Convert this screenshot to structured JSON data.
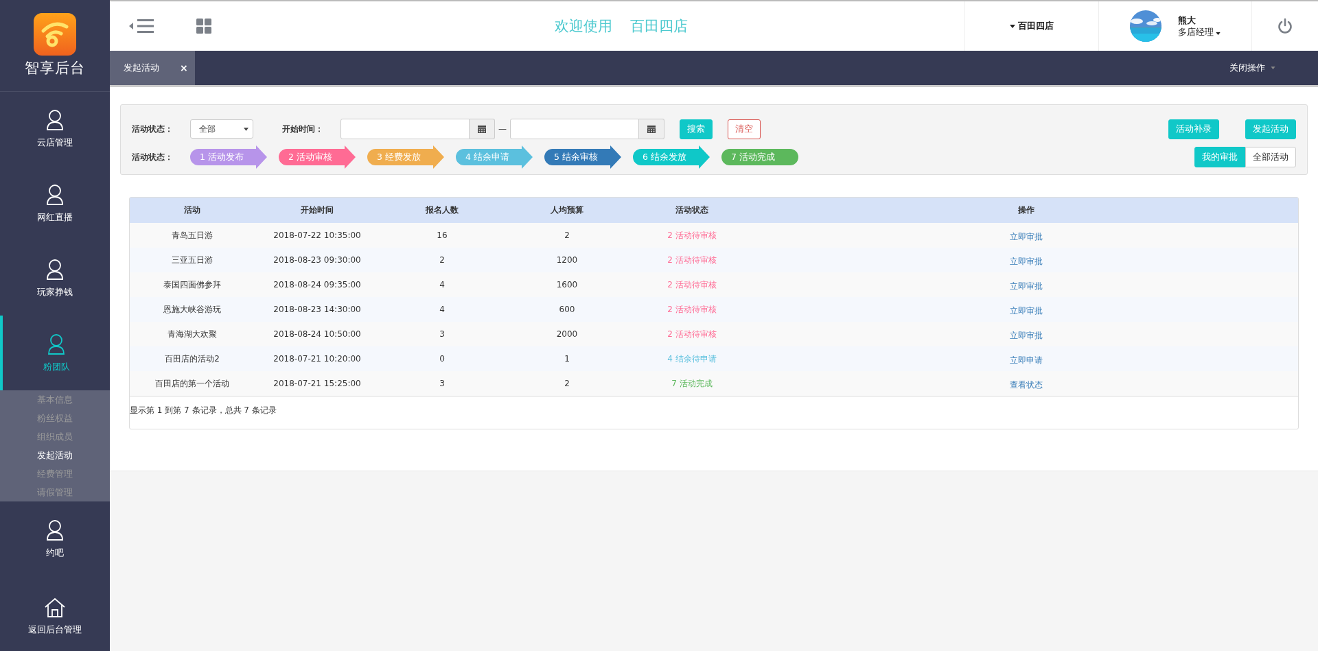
{
  "sidebar": {
    "logo_text": "智享后台",
    "items": [
      {
        "label": "云店管理",
        "kind": "user",
        "selected": false
      },
      {
        "label": "网红直播",
        "kind": "user",
        "selected": false
      },
      {
        "label": "玩家挣钱",
        "kind": "user",
        "selected": false
      },
      {
        "label": "粉团队",
        "kind": "user",
        "selected": true,
        "children": [
          {
            "label": "基本信息",
            "selected": false
          },
          {
            "label": "粉丝权益",
            "selected": false
          },
          {
            "label": "组织成员",
            "selected": false
          },
          {
            "label": "发起活动",
            "selected": true
          },
          {
            "label": "经费管理",
            "selected": false
          },
          {
            "label": "请假管理",
            "selected": false
          }
        ]
      },
      {
        "label": "约吧",
        "kind": "user",
        "selected": false
      },
      {
        "label": "返回后台管理",
        "kind": "home",
        "selected": false
      }
    ]
  },
  "header": {
    "welcome": "欢迎使用",
    "store_title": "百田四店",
    "store_menu": "百田四店",
    "user_name": "熊大",
    "user_role": "多店经理"
  },
  "tabs": [
    {
      "label": "发起活动",
      "selected": true,
      "close": "×"
    }
  ],
  "close_actions": "关闭操作",
  "filters": {
    "status_label": "活动状态：",
    "status_value": "全部",
    "time_label": "开始时间：",
    "separator": "—",
    "search": "搜索",
    "clear": "清空",
    "supplement": "活动补录",
    "launch": "发起活动",
    "steps_label": "活动状态：",
    "steps": [
      {
        "label": "1 活动发布",
        "color": "#b794ea"
      },
      {
        "label": "2 活动审核",
        "color": "#ff6b94"
      },
      {
        "label": "3 经费发放",
        "color": "#f0ad4e"
      },
      {
        "label": "4 结余申请",
        "color": "#5bc0de"
      },
      {
        "label": "5 结余审核",
        "color": "#337ab7"
      },
      {
        "label": "6 结余发放",
        "color": "#0fc8c8"
      },
      {
        "label": "7 活动完成",
        "color": "#5cb85c"
      }
    ],
    "views": [
      {
        "label": "我的审批",
        "selected": true
      },
      {
        "label": "全部活动",
        "selected": false
      }
    ]
  },
  "table": {
    "columns": [
      "活动",
      "开始时间",
      "报名人数",
      "人均预算",
      "活动状态",
      "操作"
    ],
    "rows": [
      {
        "cells": [
          "青岛五日游",
          "2018-07-22 10:35:00",
          "16",
          "2"
        ],
        "status": "2 活动待审核",
        "color": "#ff6b94",
        "action": "立即审批"
      },
      {
        "cells": [
          "三亚五日游",
          "2018-08-23 09:30:00",
          "2",
          "1200"
        ],
        "status": "2 活动待审核",
        "color": "#ff6b94",
        "action": "立即审批"
      },
      {
        "cells": [
          "泰国四面佛参拜",
          "2018-08-24 09:35:00",
          "4",
          "1600"
        ],
        "status": "2 活动待审核",
        "color": "#ff6b94",
        "action": "立即审批"
      },
      {
        "cells": [
          "恩施大峡谷游玩",
          "2018-08-23 14:30:00",
          "4",
          "600"
        ],
        "status": "2 活动待审核",
        "color": "#ff6b94",
        "action": "立即审批"
      },
      {
        "cells": [
          "青海湖大欢聚",
          "2018-08-24 10:50:00",
          "3",
          "2000"
        ],
        "status": "2 活动待审核",
        "color": "#ff6b94",
        "action": "立即审批"
      },
      {
        "cells": [
          "百田店的活动2",
          "2018-07-21 10:20:00",
          "0",
          "1"
        ],
        "status": "4 结余待申请",
        "color": "#5bc0de",
        "action": "立即申请"
      },
      {
        "cells": [
          "百田店的第一个活动",
          "2018-07-21 15:25:00",
          "3",
          "2"
        ],
        "status": "7 活动完成",
        "color": "#5cb85c",
        "action": "查看状态"
      }
    ],
    "footer": "显示第 1 到第 7 条记录，总共 7 条记录"
  }
}
